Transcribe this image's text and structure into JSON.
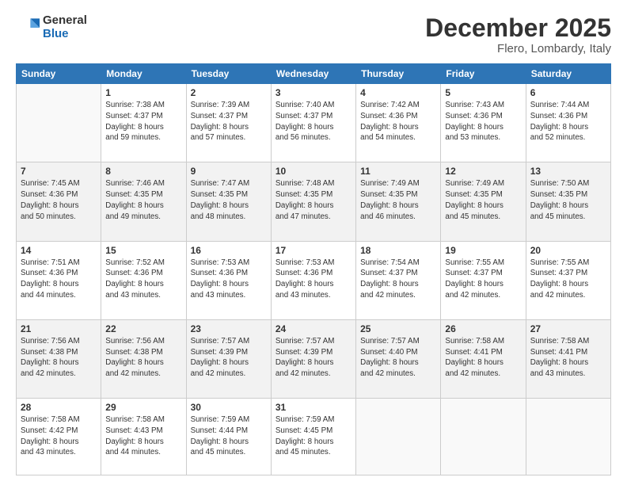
{
  "logo": {
    "general": "General",
    "blue": "Blue"
  },
  "header": {
    "month": "December 2025",
    "location": "Flero, Lombardy, Italy"
  },
  "weekdays": [
    "Sunday",
    "Monday",
    "Tuesday",
    "Wednesday",
    "Thursday",
    "Friday",
    "Saturday"
  ],
  "weeks": [
    [
      {
        "day": "",
        "info": ""
      },
      {
        "day": "1",
        "info": "Sunrise: 7:38 AM\nSunset: 4:37 PM\nDaylight: 8 hours\nand 59 minutes."
      },
      {
        "day": "2",
        "info": "Sunrise: 7:39 AM\nSunset: 4:37 PM\nDaylight: 8 hours\nand 57 minutes."
      },
      {
        "day": "3",
        "info": "Sunrise: 7:40 AM\nSunset: 4:37 PM\nDaylight: 8 hours\nand 56 minutes."
      },
      {
        "day": "4",
        "info": "Sunrise: 7:42 AM\nSunset: 4:36 PM\nDaylight: 8 hours\nand 54 minutes."
      },
      {
        "day": "5",
        "info": "Sunrise: 7:43 AM\nSunset: 4:36 PM\nDaylight: 8 hours\nand 53 minutes."
      },
      {
        "day": "6",
        "info": "Sunrise: 7:44 AM\nSunset: 4:36 PM\nDaylight: 8 hours\nand 52 minutes."
      }
    ],
    [
      {
        "day": "7",
        "info": "Sunrise: 7:45 AM\nSunset: 4:36 PM\nDaylight: 8 hours\nand 50 minutes."
      },
      {
        "day": "8",
        "info": "Sunrise: 7:46 AM\nSunset: 4:35 PM\nDaylight: 8 hours\nand 49 minutes."
      },
      {
        "day": "9",
        "info": "Sunrise: 7:47 AM\nSunset: 4:35 PM\nDaylight: 8 hours\nand 48 minutes."
      },
      {
        "day": "10",
        "info": "Sunrise: 7:48 AM\nSunset: 4:35 PM\nDaylight: 8 hours\nand 47 minutes."
      },
      {
        "day": "11",
        "info": "Sunrise: 7:49 AM\nSunset: 4:35 PM\nDaylight: 8 hours\nand 46 minutes."
      },
      {
        "day": "12",
        "info": "Sunrise: 7:49 AM\nSunset: 4:35 PM\nDaylight: 8 hours\nand 45 minutes."
      },
      {
        "day": "13",
        "info": "Sunrise: 7:50 AM\nSunset: 4:35 PM\nDaylight: 8 hours\nand 45 minutes."
      }
    ],
    [
      {
        "day": "14",
        "info": "Sunrise: 7:51 AM\nSunset: 4:36 PM\nDaylight: 8 hours\nand 44 minutes."
      },
      {
        "day": "15",
        "info": "Sunrise: 7:52 AM\nSunset: 4:36 PM\nDaylight: 8 hours\nand 43 minutes."
      },
      {
        "day": "16",
        "info": "Sunrise: 7:53 AM\nSunset: 4:36 PM\nDaylight: 8 hours\nand 43 minutes."
      },
      {
        "day": "17",
        "info": "Sunrise: 7:53 AM\nSunset: 4:36 PM\nDaylight: 8 hours\nand 43 minutes."
      },
      {
        "day": "18",
        "info": "Sunrise: 7:54 AM\nSunset: 4:37 PM\nDaylight: 8 hours\nand 42 minutes."
      },
      {
        "day": "19",
        "info": "Sunrise: 7:55 AM\nSunset: 4:37 PM\nDaylight: 8 hours\nand 42 minutes."
      },
      {
        "day": "20",
        "info": "Sunrise: 7:55 AM\nSunset: 4:37 PM\nDaylight: 8 hours\nand 42 minutes."
      }
    ],
    [
      {
        "day": "21",
        "info": "Sunrise: 7:56 AM\nSunset: 4:38 PM\nDaylight: 8 hours\nand 42 minutes."
      },
      {
        "day": "22",
        "info": "Sunrise: 7:56 AM\nSunset: 4:38 PM\nDaylight: 8 hours\nand 42 minutes."
      },
      {
        "day": "23",
        "info": "Sunrise: 7:57 AM\nSunset: 4:39 PM\nDaylight: 8 hours\nand 42 minutes."
      },
      {
        "day": "24",
        "info": "Sunrise: 7:57 AM\nSunset: 4:39 PM\nDaylight: 8 hours\nand 42 minutes."
      },
      {
        "day": "25",
        "info": "Sunrise: 7:57 AM\nSunset: 4:40 PM\nDaylight: 8 hours\nand 42 minutes."
      },
      {
        "day": "26",
        "info": "Sunrise: 7:58 AM\nSunset: 4:41 PM\nDaylight: 8 hours\nand 42 minutes."
      },
      {
        "day": "27",
        "info": "Sunrise: 7:58 AM\nSunset: 4:41 PM\nDaylight: 8 hours\nand 43 minutes."
      }
    ],
    [
      {
        "day": "28",
        "info": "Sunrise: 7:58 AM\nSunset: 4:42 PM\nDaylight: 8 hours\nand 43 minutes."
      },
      {
        "day": "29",
        "info": "Sunrise: 7:58 AM\nSunset: 4:43 PM\nDaylight: 8 hours\nand 44 minutes."
      },
      {
        "day": "30",
        "info": "Sunrise: 7:59 AM\nSunset: 4:44 PM\nDaylight: 8 hours\nand 45 minutes."
      },
      {
        "day": "31",
        "info": "Sunrise: 7:59 AM\nSunset: 4:45 PM\nDaylight: 8 hours\nand 45 minutes."
      },
      {
        "day": "",
        "info": ""
      },
      {
        "day": "",
        "info": ""
      },
      {
        "day": "",
        "info": ""
      }
    ]
  ]
}
